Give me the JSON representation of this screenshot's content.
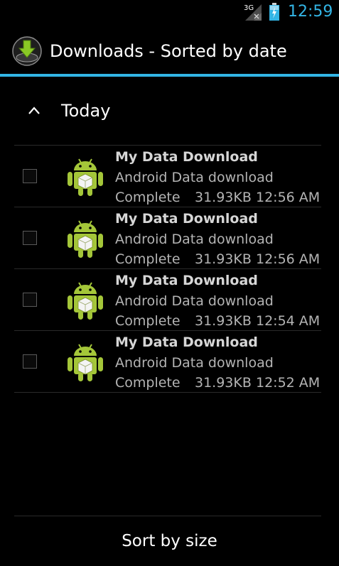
{
  "status_bar": {
    "network": "3G",
    "time": "12:59",
    "icons": [
      "signal-icon",
      "battery-icon"
    ],
    "accent_color": "#33b5e5"
  },
  "action_bar": {
    "title": "Downloads - Sorted by date",
    "icon": "download-arrow-icon"
  },
  "group": {
    "title": "Today",
    "expanded": true,
    "icon": "chevron-up-icon"
  },
  "downloads": [
    {
      "title": "My Data Download",
      "description": "Android Data download",
      "status": "Complete",
      "size": "31.93KB",
      "time": "12:56 AM",
      "checked": false,
      "icon": "android-package-icon"
    },
    {
      "title": "My Data Download",
      "description": "Android Data download",
      "status": "Complete",
      "size": "31.93KB",
      "time": "12:56 AM",
      "checked": false,
      "icon": "android-package-icon"
    },
    {
      "title": "My Data Download",
      "description": "Android Data download",
      "status": "Complete",
      "size": "31.93KB",
      "time": "12:54 AM",
      "checked": false,
      "icon": "android-package-icon"
    },
    {
      "title": "My Data Download",
      "description": "Android Data download",
      "status": "Complete",
      "size": "31.93KB",
      "time": "12:52 AM",
      "checked": false,
      "icon": "android-package-icon"
    }
  ],
  "footer": {
    "sort_label": "Sort by size"
  }
}
